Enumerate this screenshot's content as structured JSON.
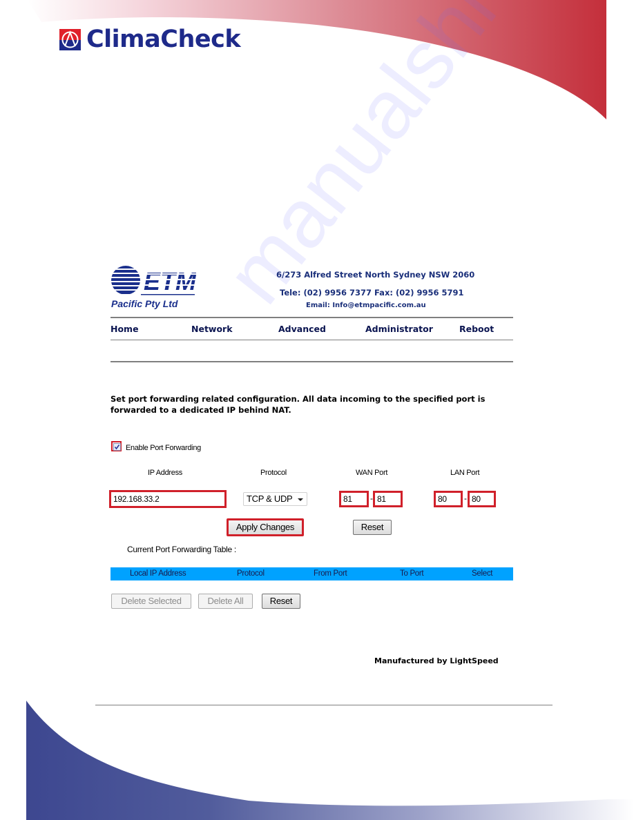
{
  "page": {
    "brand": "ClimaCheck",
    "colors": {
      "brand_blue": "#1e2a8a",
      "swoosh_red": "#c8323c",
      "swoosh_blue": "#3e4a91",
      "highlight_red": "#d0202a",
      "table_header": "#00a2ff"
    }
  },
  "router": {
    "vendor": {
      "logo_text": "ETM",
      "subtitle": "Pacific Pty Ltd",
      "address": "6/273 Alfred Street North Sydney NSW 2060",
      "phone": "Tele: (02) 9956 7377  Fax: (02) 9956 5791",
      "email": "Email: Info@etmpacific.com.au"
    },
    "nav": [
      {
        "label": "Home"
      },
      {
        "label": "Network"
      },
      {
        "label": "Advanced"
      },
      {
        "label": "Administrator"
      },
      {
        "label": "Reboot"
      }
    ],
    "description": "Set port forwarding related configuration. All data incoming to the specified port is forwarded to a dedicated IP behind NAT.",
    "enable": {
      "label": "Enable Port Forwarding",
      "checked": true
    },
    "columns": {
      "ip": "IP Address",
      "protocol": "Protocol",
      "wan": "WAN Port",
      "lan": "LAN Port"
    },
    "form": {
      "ip_address": "192.168.33.2",
      "protocol": "TCP & UDP",
      "wan_from": "81",
      "wan_to": "81",
      "lan_from": "80",
      "lan_to": "80",
      "separator": "-"
    },
    "buttons": {
      "apply": "Apply Changes",
      "reset": "Reset",
      "delete_selected": "Delete Selected",
      "delete_all": "Delete All",
      "table_reset": "Reset"
    },
    "table": {
      "title": "Current Port Forwarding Table :",
      "headers": [
        "Local IP Address",
        "Protocol",
        "From Port",
        "To Port",
        "Select"
      ],
      "rows": []
    },
    "footer": "Manufactured by LightSpeed"
  },
  "watermark": "manualshive.com"
}
